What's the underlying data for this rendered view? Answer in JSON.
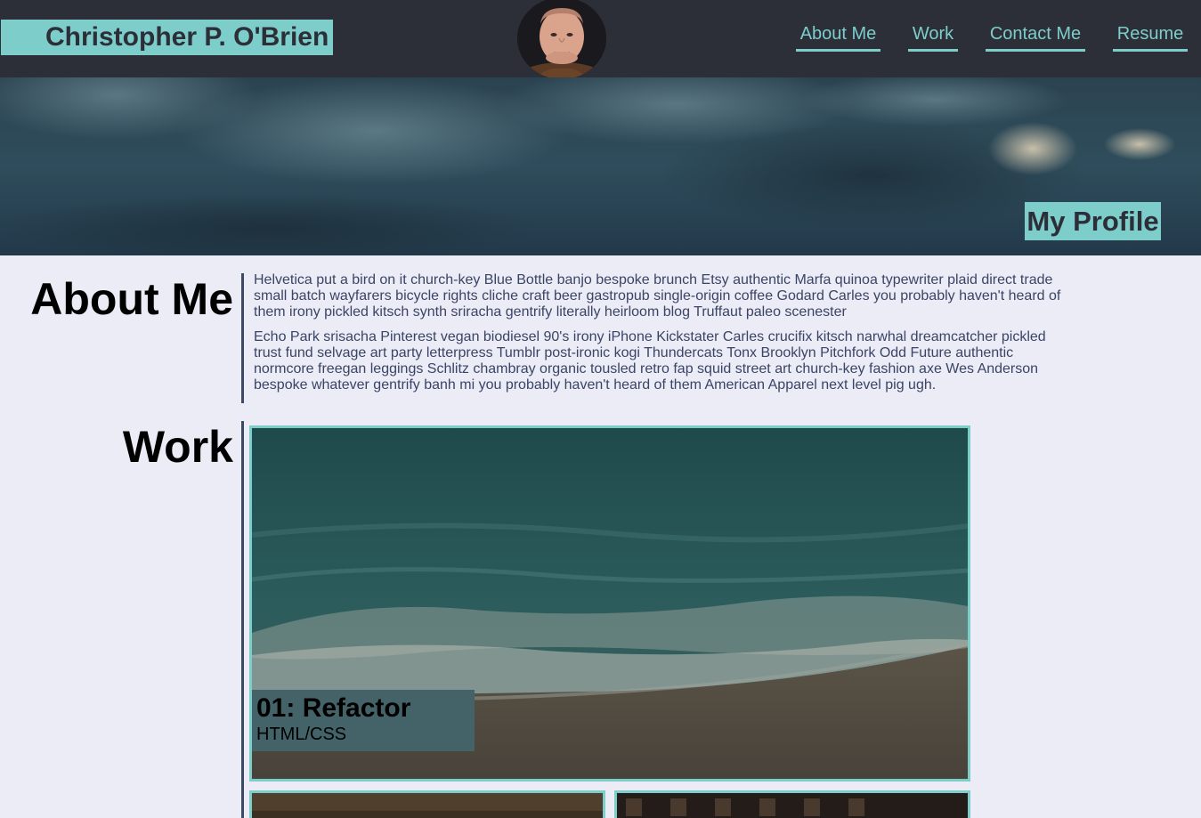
{
  "header": {
    "name": "Christopher P. O'Brien",
    "nav": [
      {
        "label": "About Me"
      },
      {
        "label": "Work"
      },
      {
        "label": "Contact Me"
      },
      {
        "label": "Resume"
      }
    ]
  },
  "hero": {
    "title": "My Profile"
  },
  "about": {
    "heading": "About Me",
    "paragraphs": [
      "Helvetica put a bird on it church-key Blue Bottle banjo bespoke brunch Etsy authentic Marfa quinoa typewriter plaid direct trade small batch wayfarers bicycle rights cliche craft beer gastropub single-origin coffee Godard Carles you probably haven't heard of them irony pickled kitsch synth sriracha gentrify literally heirloom blog Truffaut paleo scenester",
      "Echo Park srisacha Pinterest vegan biodiesel 90's irony iPhone Kickstater Carles crucifix kitsch narwhal dreamcatcher pickled trust fund selvage art party letterpress Tumblr post-ironic kogi Thundercats Tonx Brooklyn Pitchfork Odd Future authentic normcore freegan leggings Schlitz chambray organic tousled retro fap squid street art church-key fashion axe Wes Anderson bespoke whatever gentrify banh mi you probably haven't heard of them American Apparel next level pig ugh."
    ]
  },
  "work": {
    "heading": "Work",
    "projects": [
      {
        "title": "01: Refactor",
        "subtitle": "HTML/CSS"
      }
    ]
  },
  "colors": {
    "header_bg": "#2C2F38",
    "accent": "#7DCDCB",
    "page_bg": "#ECECF6",
    "rule": "#3D4A66",
    "label_bg": "#436368"
  },
  "icons": {
    "avatar": "portrait-photo"
  }
}
